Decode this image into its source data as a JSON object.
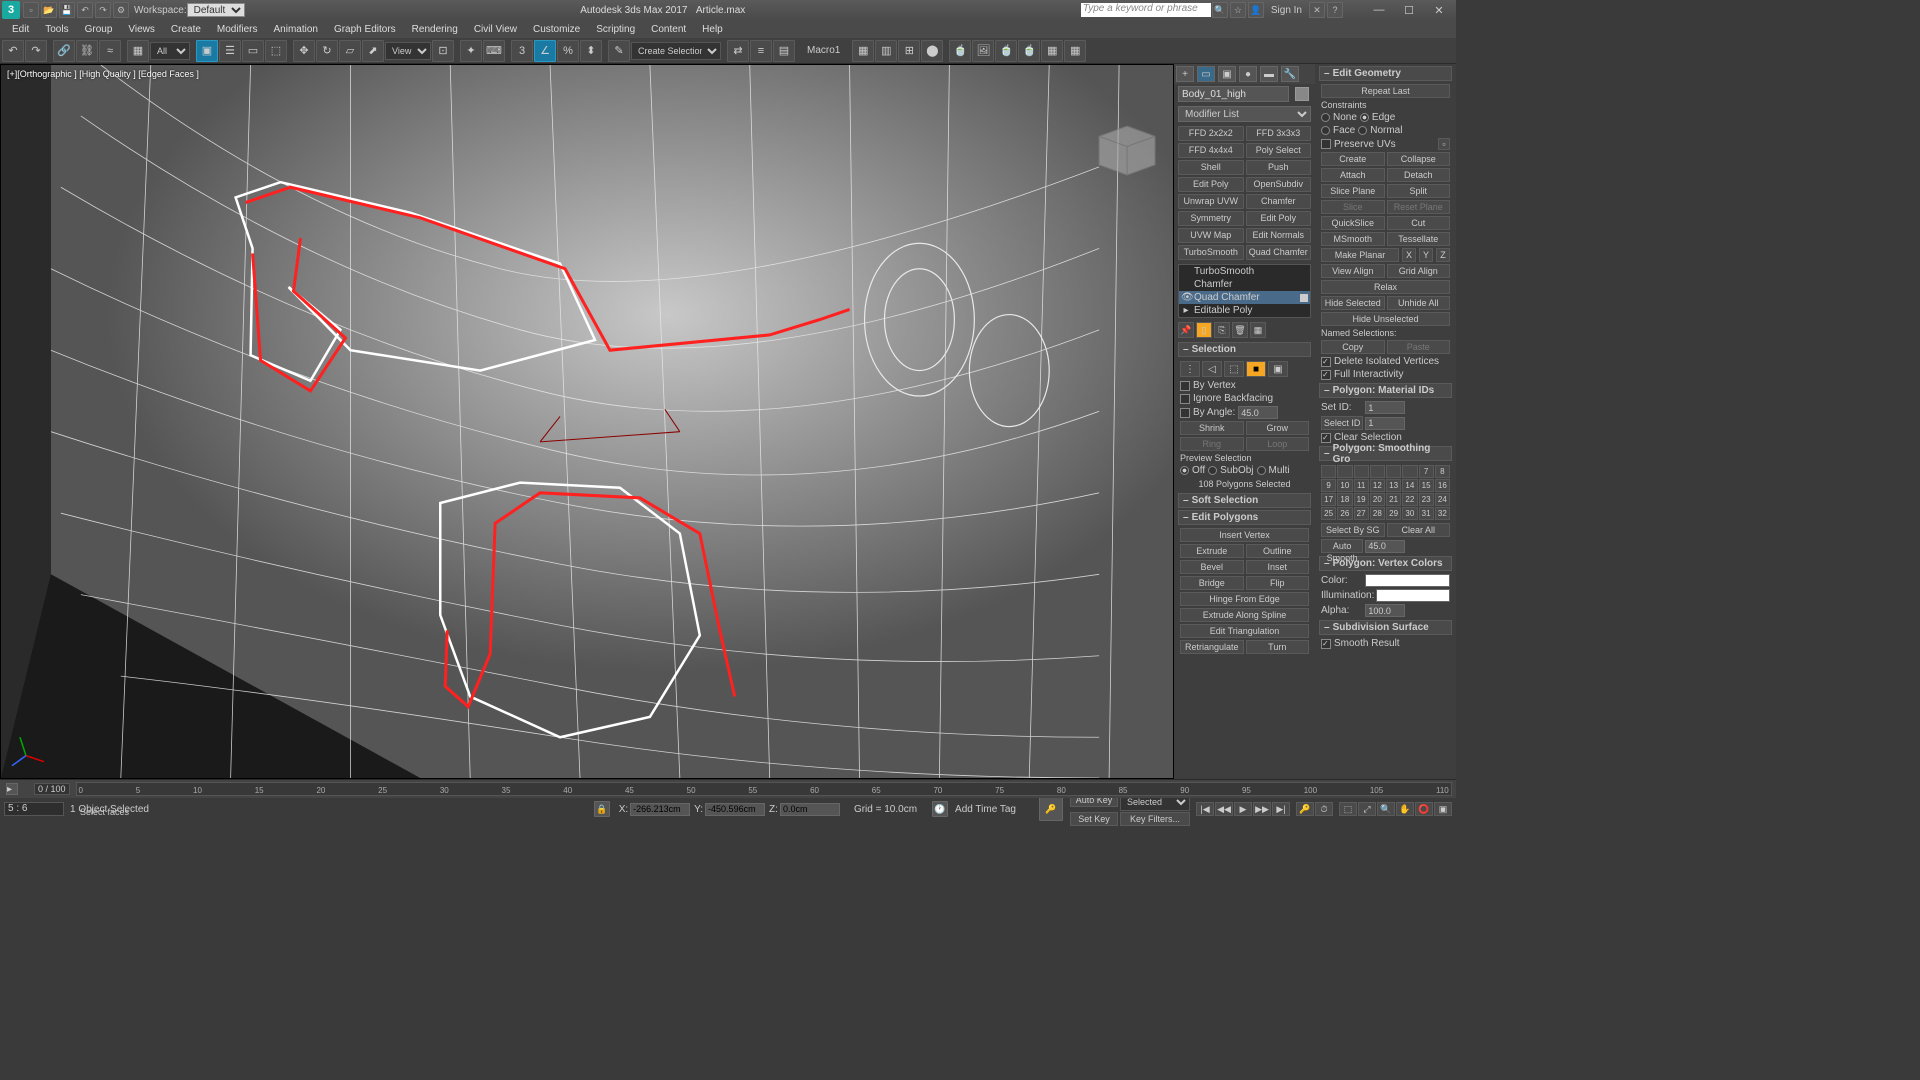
{
  "title": {
    "app": "Autodesk 3ds Max 2017",
    "file": "Article.max",
    "workspace_label": "Workspace:",
    "workspace": "Default",
    "search_ph": "Type a keyword or phrase",
    "signin": "Sign In"
  },
  "menus": [
    "Edit",
    "Tools",
    "Group",
    "Views",
    "Create",
    "Modifiers",
    "Animation",
    "Graph Editors",
    "Rendering",
    "Civil View",
    "Customize",
    "Scripting",
    "Content",
    "Help"
  ],
  "toolbar": {
    "all": "All",
    "view": "View",
    "selset": "Create Selection Se",
    "macro": "Macro1"
  },
  "viewport": {
    "label": "[+][Orthographic ] [High Quality ] [Edged Faces ]"
  },
  "modpanel": {
    "obj": "Body_01_high",
    "modlist": "Modifier List",
    "mods": [
      "FFD 2x2x2",
      "FFD 3x3x3",
      "FFD 4x4x4",
      "Poly Select",
      "Shell",
      "Push",
      "Edit Poly",
      "OpenSubdiv",
      "Unwrap UVW",
      "Chamfer",
      "Symmetry",
      "Edit Poly",
      "UVW Map",
      "Edit Normals",
      "TurboSmooth",
      "Quad Chamfer"
    ],
    "stack": [
      "TurboSmooth",
      "Chamfer",
      "Quad Chamfer",
      "Editable Poly"
    ]
  },
  "selection": {
    "hdr": "Selection",
    "byv": "By Vertex",
    "ignbf": "Ignore Backfacing",
    "byang": "By Angle:",
    "byang_v": "45.0",
    "shrink": "Shrink",
    "grow": "Grow",
    "ring": "Ring",
    "loop": "Loop",
    "prev": "Preview Selection",
    "off": "Off",
    "subobj": "SubObj",
    "multi": "Multi",
    "count": "108 Polygons Selected",
    "soft": "Soft Selection",
    "editpoly": "Edit Polygons",
    "insv": "Insert Vertex",
    "extrude": "Extrude",
    "outline": "Outline",
    "bevel": "Bevel",
    "inset": "Inset",
    "bridge": "Bridge",
    "flip": "Flip",
    "hfe": "Hinge From Edge",
    "eas": "Extrude Along Spline",
    "etri": "Edit Triangulation",
    "retri": "Retriangulate",
    "turn": "Turn"
  },
  "editgeo": {
    "hdr": "Edit Geometry",
    "repeat": "Repeat Last",
    "constraints": "Constraints",
    "none": "None",
    "edge": "Edge",
    "face": "Face",
    "normal": "Normal",
    "presuv": "Preserve UVs",
    "create": "Create",
    "collapse": "Collapse",
    "attach": "Attach",
    "detach": "Detach",
    "slicep": "Slice Plane",
    "split": "Split",
    "slice": "Slice",
    "resetp": "Reset Plane",
    "quicks": "QuickSlice",
    "cut": "Cut",
    "msmooth": "MSmooth",
    "tess": "Tessellate",
    "makep": "Make Planar",
    "xyz": [
      "X",
      "Y",
      "Z"
    ],
    "valign": "View Align",
    "galign": "Grid Align",
    "relax": "Relax",
    "hides": "Hide Selected",
    "unhide": "Unhide All",
    "hideun": "Hide Unselected",
    "namedsel": "Named Selections:",
    "copy": "Copy",
    "paste": "Paste",
    "deliso": "Delete Isolated Vertices",
    "fullint": "Full Interactivity"
  },
  "matid": {
    "hdr": "Polygon: Material IDs",
    "setid": "Set ID:",
    "setid_v": "1",
    "selid": "Select ID",
    "selid_v": "1",
    "clear": "Clear Selection"
  },
  "smooth": {
    "hdr": "Polygon: Smoothing Gro",
    "selsg": "Select By SG",
    "clear": "Clear All",
    "auto": "Auto Smooth",
    "auto_v": "45.0"
  },
  "vcolor": {
    "hdr": "Polygon: Vertex Colors",
    "color": "Color:",
    "illum": "Illumination:",
    "alpha": "Alpha:",
    "alpha_v": "100.0"
  },
  "subsurf": {
    "hdr": "Subdivision Surface",
    "smres": "Smooth Result"
  },
  "status": {
    "selcount": "1 Object Selected",
    "prompt": "Select faces",
    "frame": "0 / 100",
    "sele": "5 : 6",
    "x": "X:",
    "xv": "-266.213cm",
    "y": "Y:",
    "yv": "-450.596cm",
    "z": "Z:",
    "zv": "0.0cm",
    "grid": "Grid = 10.0cm",
    "autokey": "Auto Key",
    "selected": "Selected",
    "setkey": "Set Key",
    "keyf": "Key Filters...",
    "addtag": "Add Time Tag"
  },
  "ticks": [
    "0",
    "5",
    "10",
    "15",
    "20",
    "25",
    "30",
    "35",
    "40",
    "45",
    "50",
    "55",
    "60",
    "65",
    "70",
    "75",
    "80",
    "85",
    "90",
    "95",
    "100",
    "105",
    "110"
  ]
}
